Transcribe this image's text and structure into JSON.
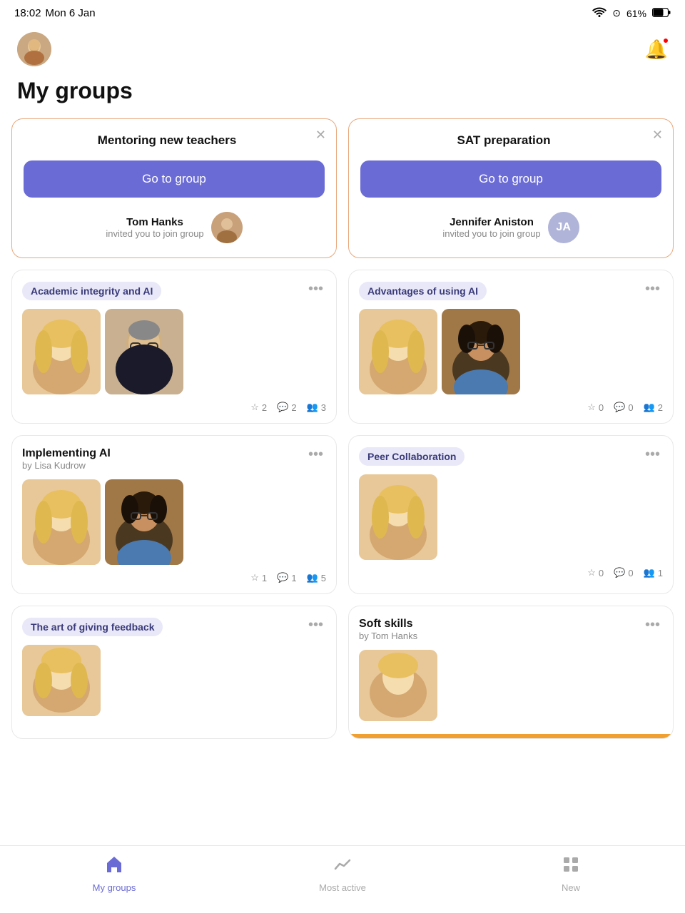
{
  "statusBar": {
    "time": "18:02",
    "day": "Mon 6 Jan",
    "battery": "61%"
  },
  "header": {
    "notificationBell": "🔔"
  },
  "pageTitle": "My groups",
  "inviteCards": [
    {
      "id": "mentoring",
      "title": "Mentoring new teachers",
      "goToGroupLabel": "Go to group",
      "inviterName": "Tom Hanks",
      "inviterSub": "invited you to join group",
      "avatarType": "photo"
    },
    {
      "id": "sat",
      "title": "SAT preparation",
      "goToGroupLabel": "Go to group",
      "inviterName": "Jennifer Aniston",
      "inviterSub": "invited you to join group",
      "avatarType": "initials",
      "initials": "JA"
    }
  ],
  "groupCards": [
    {
      "id": "academic-ai",
      "tag": "Academic integrity and AI",
      "hasTag": true,
      "name": null,
      "author": null,
      "members": 2,
      "stats": {
        "stars": 2,
        "comments": 2,
        "members": 3
      }
    },
    {
      "id": "advantages-ai",
      "tag": "Advantages of using AI",
      "hasTag": true,
      "name": null,
      "author": null,
      "members": 2,
      "stats": {
        "stars": 0,
        "comments": 0,
        "members": 2
      }
    },
    {
      "id": "implementing-ai",
      "tag": null,
      "hasTag": false,
      "name": "Implementing AI",
      "author": "by Lisa Kudrow",
      "members": 2,
      "stats": {
        "stars": 1,
        "comments": 1,
        "members": 5
      }
    },
    {
      "id": "peer-collab",
      "tag": "Peer Collaboration",
      "hasTag": true,
      "name": null,
      "author": null,
      "members": 1,
      "stats": {
        "stars": 0,
        "comments": 0,
        "members": 1
      }
    },
    {
      "id": "art-feedback",
      "tag": "The art of giving feedback",
      "hasTag": true,
      "name": null,
      "author": null,
      "members": 1,
      "stats": null
    },
    {
      "id": "soft-skills",
      "tag": null,
      "hasTag": false,
      "name": "Soft skills",
      "author": "by Tom Hanks",
      "members": 1,
      "stats": null,
      "hasOrangeBar": true
    }
  ],
  "bottomNav": [
    {
      "id": "my-groups",
      "label": "My groups",
      "active": true
    },
    {
      "id": "most-active",
      "label": "Most active",
      "active": false
    },
    {
      "id": "new",
      "label": "New",
      "active": false
    }
  ]
}
